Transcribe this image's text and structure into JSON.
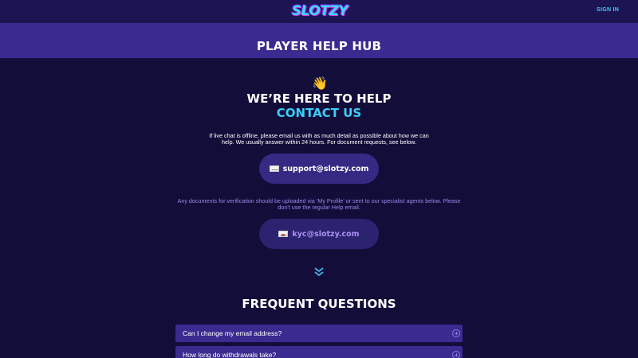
{
  "header": {
    "logo_text": "SLOTZY",
    "signin_label": "SIGN IN"
  },
  "hero": {
    "title": "PLAYER HELP HUB"
  },
  "help": {
    "wave_emoji": "👋",
    "title": "WE’RE HERE TO HELP",
    "subtitle": "CONTACT US",
    "intro": "If live chat is offline, please email us with as much detail as possible about how we can help. We usually answer within 24 hours. For document requests, see below."
  },
  "emails": {
    "support": "support@slotzy.com",
    "documents_note": "Any documents for verification should be uploaded via ‘My Profile’ or sent to our specialist agents below. Please don’t use the regular Help email.",
    "kyc": "kyc@slotzy.com"
  },
  "faq": {
    "title": "FREQUENT QUESTIONS",
    "items": [
      {
        "question": "Can I change my email address?"
      },
      {
        "question": "How long do withdrawals take?"
      }
    ]
  },
  "icons": {
    "support_icon": "envelope-icon",
    "kyc_icon": "envelope-with-seal-icon",
    "scroll_icon": "double-chevron-down-icon",
    "faq_icon": "plus-circle-icon"
  },
  "colors": {
    "background": "#130d3a",
    "header": "#1d1553",
    "hero": "#3b2b90",
    "accent": "#39d0f7",
    "muted_purple": "#9b87e8"
  }
}
